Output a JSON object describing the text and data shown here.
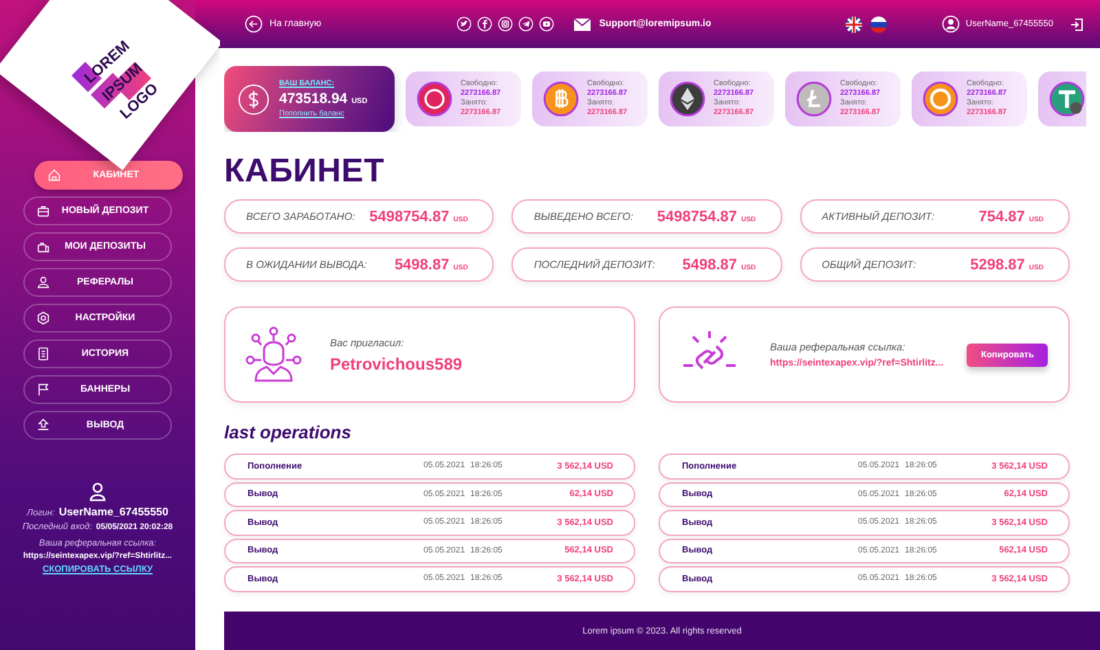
{
  "header": {
    "home_link": "На главную",
    "support_email": "Support@loremipsum.io",
    "username": "UserName_67455550"
  },
  "logo": {
    "lines": [
      "LOREM",
      "IPSUM",
      "LOGO"
    ]
  },
  "sidebar": {
    "items": [
      {
        "label": "КАБИНЕТ",
        "selected": true
      },
      {
        "label": "НОВЫЙ ДЕПОЗИТ",
        "selected": false
      },
      {
        "label": "МОИ ДЕПОЗИТЫ",
        "selected": false
      },
      {
        "label": "РЕФЕРАЛЫ",
        "selected": false
      },
      {
        "label": "НАСТРОЙКИ",
        "selected": false
      },
      {
        "label": "ИСТОРИЯ",
        "selected": false
      },
      {
        "label": "БАННЕРЫ",
        "selected": false
      },
      {
        "label": "ВЫВОД",
        "selected": false
      }
    ],
    "user": {
      "login_label": "Логин:",
      "login": "UserName_67455550",
      "last_login_label": "Последний вход:",
      "last_login": "05/05/2021 20:02:28",
      "ref_label": "Ваша реферальная ссылка:",
      "ref_url": "https://seintexapex.vip/?ref=Shtirlitz...",
      "copy_link": "СКОПИРОВАТЬ ССЫЛКУ"
    }
  },
  "balance": {
    "label": "ВАШ БАЛАНС:",
    "amount": "473518.94",
    "currency": "USD",
    "topup": "Пополнить баланс"
  },
  "wallets": [
    {
      "kind": "pm",
      "free_label": "Свободно:",
      "free": "2273166.87",
      "busy_label": "Занято:",
      "busy": "2273166.87"
    },
    {
      "kind": "btc",
      "free_label": "Свободно:",
      "free": "2273166.87",
      "busy_label": "Занято:",
      "busy": "2273166.87"
    },
    {
      "kind": "eth",
      "free_label": "Свободно:",
      "free": "2273166.87",
      "busy_label": "Занято:",
      "busy": "2273166.87"
    },
    {
      "kind": "ltc",
      "free_label": "Свободно:",
      "free": "2273166.87",
      "busy_label": "Занято:",
      "busy": "2273166.87"
    },
    {
      "kind": "bch",
      "free_label": "Свободно:",
      "free": "2273166.87",
      "busy_label": "Занято:",
      "busy": "2273166.87"
    },
    {
      "kind": "usdt"
    }
  ],
  "title": "КАБИНЕТ",
  "stats": [
    {
      "label": "ВСЕГО ЗАРАБОТАНО:",
      "value": "5498754.87",
      "currency": "USD"
    },
    {
      "label": "ВЫВЕДЕНО ВСЕГО:",
      "value": "5498754.87",
      "currency": "USD"
    },
    {
      "label": "АКТИВНЫЙ ДЕПОЗИТ:",
      "value": "754.87",
      "currency": "USD"
    },
    {
      "label": "В ОЖИДАНИИ ВЫВОДА:",
      "value": "5498.87",
      "currency": "USD"
    },
    {
      "label": "ПОСЛЕДНИЙ ДЕПОЗИТ:",
      "value": "5498.87",
      "currency": "USD"
    },
    {
      "label": "ОБЩИЙ ДЕПОЗИТ:",
      "value": "5298.87",
      "currency": "USD"
    }
  ],
  "inviter": {
    "label": "Вас пригласил:",
    "name": "Petrovichous589"
  },
  "referral": {
    "label": "Ваша реферальная ссылка:",
    "url": "https://seintexapex.vip/?ref=Shtirlitz...",
    "button": "Копировать"
  },
  "operations_title": "last operations",
  "operations": [
    [
      {
        "type": "Пополнение",
        "date": "05.05.2021",
        "time": "18:26:05",
        "amount": "3 562,14 USD"
      },
      {
        "type": "Вывод",
        "date": "05.05.2021",
        "time": "18:26:05",
        "amount": "62,14 USD"
      },
      {
        "type": "Вывод",
        "date": "05.05.2021",
        "time": "18:26:05",
        "amount": "3 562,14 USD"
      },
      {
        "type": "Вывод",
        "date": "05.05.2021",
        "time": "18:26:05",
        "amount": "562,14 USD"
      },
      {
        "type": "Вывод",
        "date": "05.05.2021",
        "time": "18:26:05",
        "amount": "3 562,14 USD"
      }
    ],
    [
      {
        "type": "Пополнение",
        "date": "05.05.2021",
        "time": "18:26:05",
        "amount": "3 562,14 USD"
      },
      {
        "type": "Вывод",
        "date": "05.05.2021",
        "time": "18:26:05",
        "amount": "62,14 USD"
      },
      {
        "type": "Вывод",
        "date": "05.05.2021",
        "time": "18:26:05",
        "amount": "3 562,14 USD"
      },
      {
        "type": "Вывод",
        "date": "05.05.2021",
        "time": "18:26:05",
        "amount": "562,14 USD"
      },
      {
        "type": "Вывод",
        "date": "05.05.2021",
        "time": "18:26:05",
        "amount": "3 562,14 USD"
      }
    ]
  ],
  "footer": "Lorem ipsum © 2023. All rights reserved"
}
